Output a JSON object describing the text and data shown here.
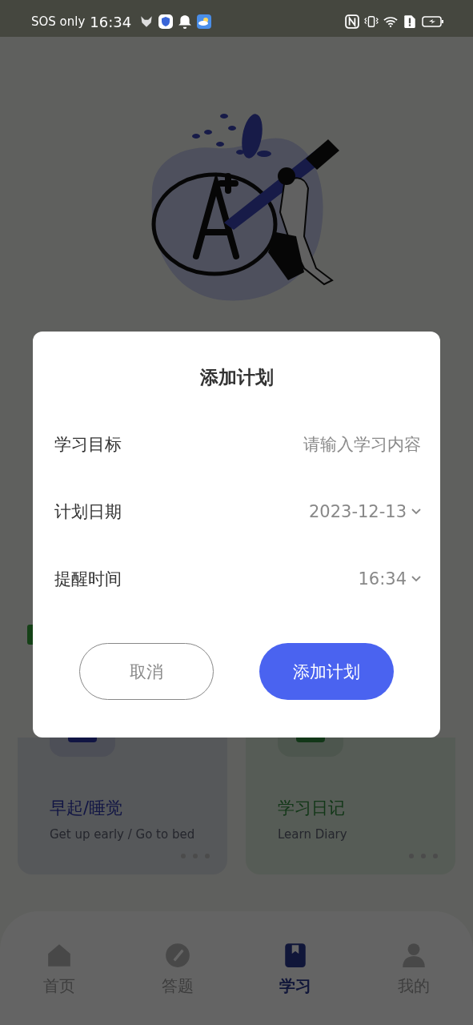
{
  "status_bar": {
    "carrier": "SOS only",
    "time": "16:34"
  },
  "dialog": {
    "title": "添加计划",
    "fields": [
      {
        "kind": "input",
        "label": "学习目标",
        "placeholder": "请输入学习内容"
      },
      {
        "kind": "picker",
        "label": "计划日期",
        "value": "2023-12-13"
      },
      {
        "kind": "picker",
        "label": "提醒时间",
        "value": "16:34"
      }
    ],
    "buttons": [
      {
        "kind": "secondary",
        "label": "取消"
      },
      {
        "kind": "primary",
        "label": "添加计划"
      }
    ]
  },
  "cards": [
    {
      "kind": "sleep",
      "title": "早起/睡觉",
      "subtitle": "Get up early / Go to bed"
    },
    {
      "kind": "diary",
      "title": "学习日记",
      "subtitle": "Learn Diary"
    }
  ],
  "tabs": [
    {
      "kind": "home",
      "label": "首页",
      "selected": false
    },
    {
      "kind": "quiz",
      "label": "答题",
      "selected": false
    },
    {
      "kind": "study",
      "label": "学习",
      "selected": true
    },
    {
      "kind": "profile",
      "label": "我的",
      "selected": false
    }
  ]
}
